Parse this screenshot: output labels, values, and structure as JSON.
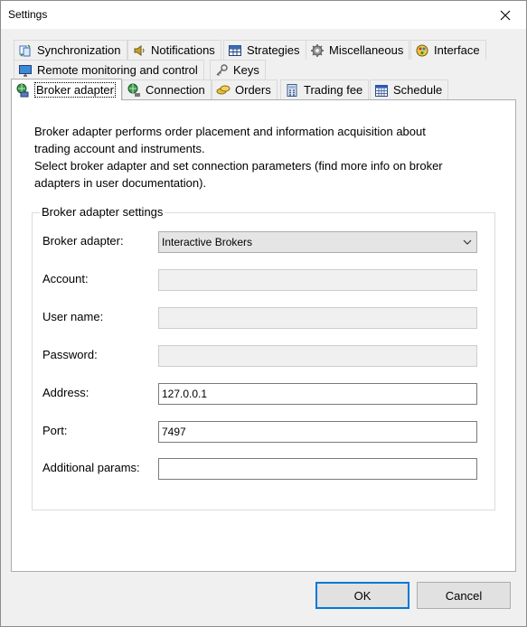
{
  "window": {
    "title": "Settings"
  },
  "tabs": {
    "row1": [
      {
        "label": "Synchronization",
        "icon": "sync-icon"
      },
      {
        "label": "Notifications",
        "icon": "speaker-icon"
      },
      {
        "label": "Strategies",
        "icon": "grid-icon"
      },
      {
        "label": "Miscellaneous",
        "icon": "gear-icon"
      },
      {
        "label": "Interface",
        "icon": "paint-icon"
      }
    ],
    "row2": [
      {
        "label": "Remote monitoring and control",
        "icon": "monitor-icon"
      },
      {
        "label": "Keys",
        "icon": "key-icon"
      }
    ],
    "row3": [
      {
        "label": "Broker adapter",
        "icon": "broker-icon",
        "active": true
      },
      {
        "label": "Connection",
        "icon": "connection-icon"
      },
      {
        "label": "Orders",
        "icon": "orders-icon"
      },
      {
        "label": "Trading fee",
        "icon": "calculator-icon"
      },
      {
        "label": "Schedule",
        "icon": "calendar-icon"
      }
    ]
  },
  "panel": {
    "description_line1": "Broker adapter performs order placement and information acquisition about",
    "description_line2": "trading account and instruments.",
    "description_line3": "Select broker adapter and set connection parameters (find more info on broker",
    "description_line4": "adapters in user documentation).",
    "group_title": "Broker adapter settings",
    "broker_label": "Broker adapter:",
    "broker_value": "Interactive Brokers",
    "account_label": "Account:",
    "account_value": "",
    "username_label": "User name:",
    "username_value": "",
    "password_label": "Password:",
    "password_value": "",
    "address_label": "Address:",
    "address_value": "127.0.0.1",
    "port_label": "Port:",
    "port_value": "7497",
    "params_label": "Additional params:",
    "params_value": ""
  },
  "buttons": {
    "ok": "OK",
    "cancel": "Cancel"
  },
  "colors": {
    "accent": "#0078d7",
    "panel_bg": "#ffffff",
    "window_bg": "#f0f0f0"
  }
}
